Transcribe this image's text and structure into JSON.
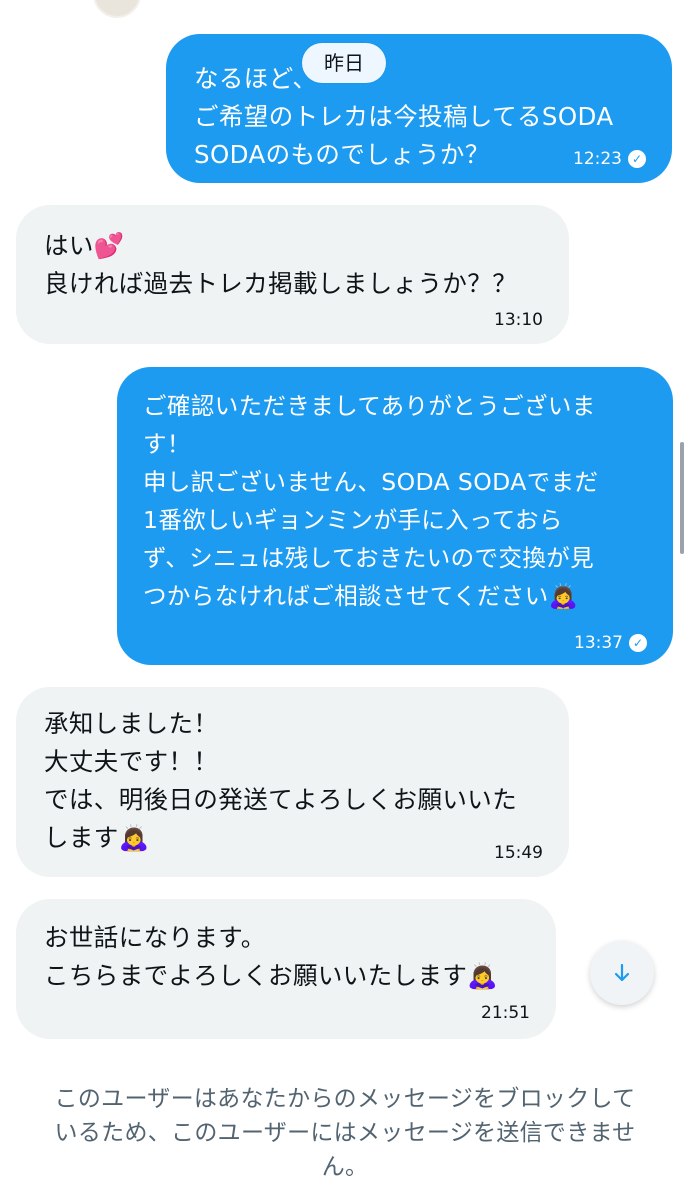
{
  "date_pill": "昨日",
  "messages": [
    {
      "direction": "out",
      "lines": [
        "なるほど、",
        "ご希望のトレカは今投稿してるSODA",
        "SODAのものでしょうか？"
      ],
      "time": "12:23",
      "read_icon": "check-circle-icon"
    },
    {
      "direction": "in",
      "lines": [
        "はい💕",
        "良ければ過去トレカ掲載しましょうか？？"
      ],
      "time": "13:10"
    },
    {
      "direction": "out",
      "lines": [
        "ご確認いただきましてありがとうございま",
        "す！",
        "申し訳ございません、SODA SODAでまだ",
        "1番欲しいギョンミンが手に入っておら",
        "ず、シニュは残しておきたいので交換が見",
        "つからなければご相談させてください🙇‍♀️"
      ],
      "time": "13:37",
      "read_icon": "check-circle-icon"
    },
    {
      "direction": "in",
      "lines": [
        "承知しました！",
        "大丈夫です！！",
        "では、明後日の発送てよろしくお願いいた",
        "します🙇‍♀️"
      ],
      "time": "15:49"
    },
    {
      "direction": "in",
      "lines": [
        "お世話になります。",
        "こちらまでよろしくお願いいたします🙇‍♀️"
      ],
      "time": "21:51"
    }
  ],
  "scroll_button_icon": "arrow-down-icon",
  "blocked_notice": [
    "このユーザーはあなたからのメッセージをブロックして",
    "いるため、このユーザーにはメッセージを送信できませ",
    "ん。"
  ],
  "colors": {
    "outgoing_bubble": "#1d9bf0",
    "incoming_bubble": "#eff3f4",
    "notice_text": "#536471"
  }
}
